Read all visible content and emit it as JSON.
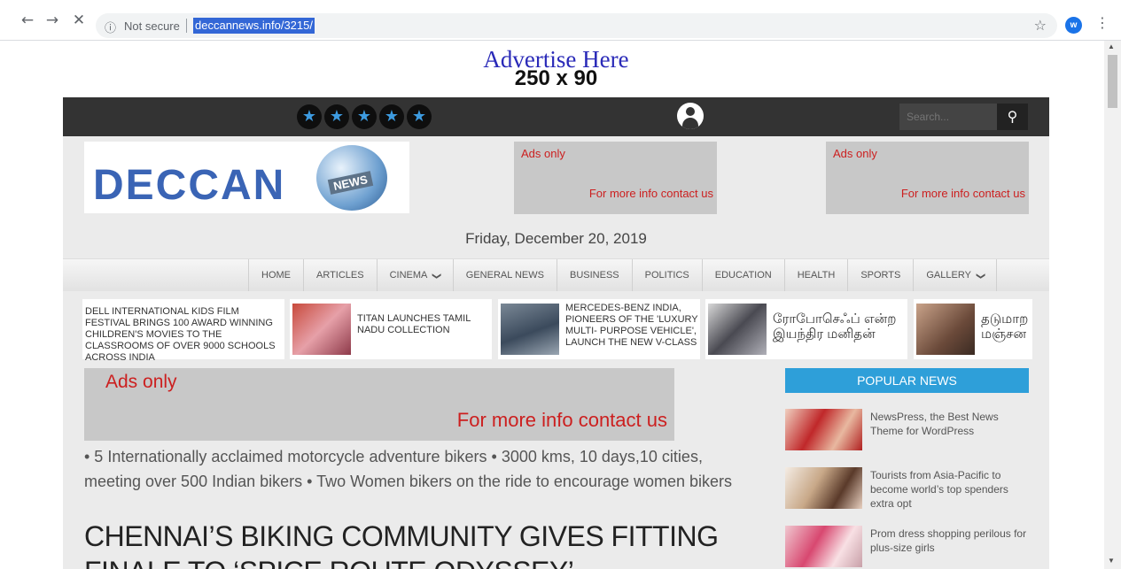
{
  "browser": {
    "back": "←",
    "forward": "→",
    "stop": "✕",
    "info_icon": "ⓘ",
    "security_label": "Not secure",
    "url": "deccannews.info/3215/",
    "bookmark_icon": "☆",
    "profile_initial": "w",
    "menu_icon": "⋮"
  },
  "top_ad": {
    "line1": "Advertise Here",
    "line2": "250 x 90"
  },
  "topbar": {
    "stars": [
      "★",
      "★",
      "★",
      "★",
      "★"
    ],
    "search_placeholder": "Search...",
    "search_icon": "⚲"
  },
  "header": {
    "logo_text": "DECCAN",
    "logo_tag": "NEWS",
    "ad1": {
      "line1": "Ads only",
      "line2": "For more info contact  us"
    },
    "ad2": {
      "line1": "Ads only",
      "line2": "For more info contact  us"
    },
    "date": "Friday, December 20, 2019"
  },
  "menu": {
    "items": [
      "HOME",
      "ARTICLES",
      "CINEMA",
      "GENERAL NEWS",
      "BUSINESS",
      "POLITICS",
      "EDUCATION",
      "HEALTH",
      "SPORTS",
      "GALLERY"
    ],
    "chevron": "❯"
  },
  "ticker": [
    {
      "text": "DELL INTERNATIONAL KIDS FILM FESTIVAL BRINGS 100 AWARD WINNING CHILDREN'S MOVIES TO THE CLASSROOMS OF OVER 9000 SCHOOLS ACROSS INDIA"
    },
    {
      "text": "TITAN LAUNCHES TAMIL NADU COLLECTION"
    },
    {
      "text": "MERCEDES-BENZ INDIA, PIONEERS OF THE 'LUXURY MULTI- PURPOSE VEHICLE', LAUNCH THE NEW V-CLASS"
    },
    {
      "text": "ரோபோசெஃப் என்ற இயந்திர மனிதன்"
    },
    {
      "text": "தடுமாற மஞ்சன"
    }
  ],
  "main_ad": {
    "line1": "Ads only",
    "line2": "For more info contact  us"
  },
  "article": {
    "lead": "• 5 Internationally acclaimed motorcycle adventure bikers • 3000 kms, 10 days,10 cities, meeting over 500 Indian bikers • Two Women bikers on the ride to encourage women bikers",
    "headline": "CHENNAI’S BIKING COMMUNITY GIVES FITTING FINALE TO ‘SPICE ROUTE ODYSSEY’"
  },
  "sidebar": {
    "heading": "POPULAR NEWS",
    "items": [
      {
        "title": "NewsPress, the Best News Theme for WordPress"
      },
      {
        "title": "Tourists from Asia-Pacific to become world’s top spenders extra opt"
      },
      {
        "title": "Prom dress shopping perilous for plus-size girls"
      }
    ]
  },
  "colors": {
    "topbar": "#333333",
    "accent": "#2e9fd9",
    "ad_text": "#cc1f1f",
    "star": "#3d9be0"
  }
}
